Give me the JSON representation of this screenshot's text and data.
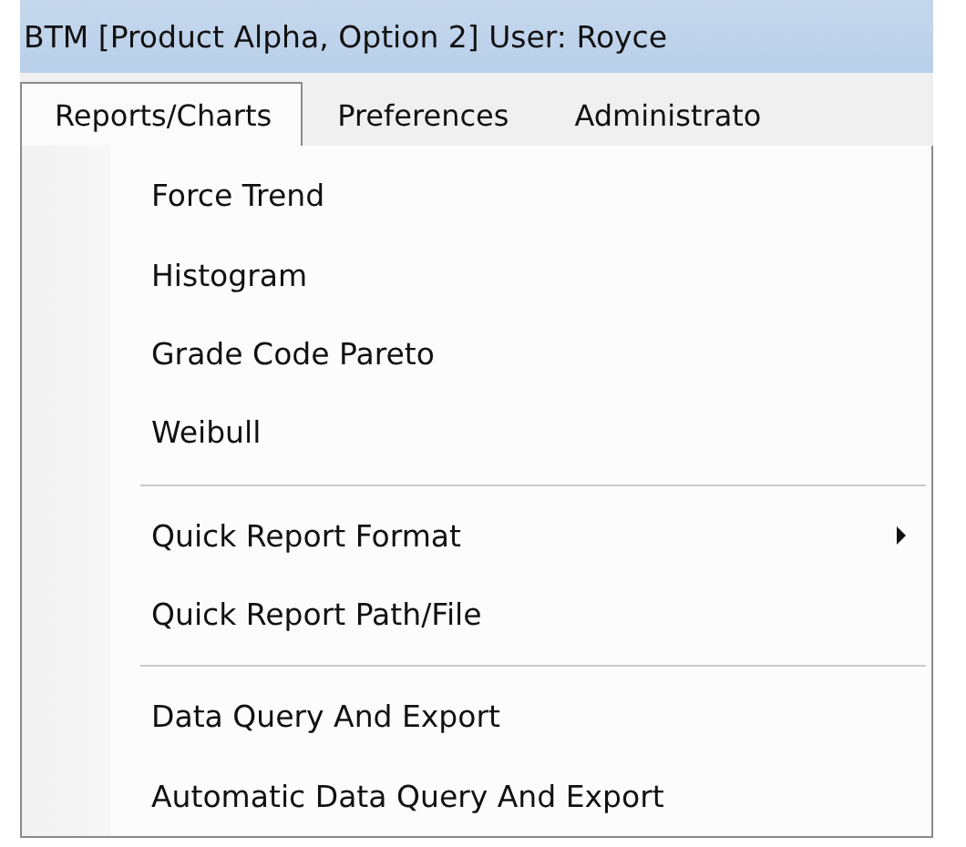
{
  "window": {
    "title": "BTM [Product Alpha, Option 2] User: Royce"
  },
  "menu_bar": [
    {
      "label": "Reports/Charts",
      "selected": true
    },
    {
      "label": "Preferences",
      "selected": false
    },
    {
      "label": "Administrato",
      "selected": false
    }
  ],
  "menu": [
    {
      "kind": "item",
      "label": "Force Trend",
      "submenu": false
    },
    {
      "kind": "item",
      "label": "Histogram",
      "submenu": false
    },
    {
      "kind": "item",
      "label": "Grade Code Pareto",
      "submenu": false
    },
    {
      "kind": "item",
      "label": "Weibull",
      "submenu": false
    },
    {
      "kind": "separator"
    },
    {
      "kind": "item",
      "label": "Quick Report Format",
      "submenu": true
    },
    {
      "kind": "item",
      "label": "Quick Report Path/File",
      "submenu": false
    },
    {
      "kind": "separator"
    },
    {
      "kind": "item",
      "label": "Data Query And Export",
      "submenu": false
    },
    {
      "kind": "item",
      "label": "Automatic Data Query And Export",
      "submenu": false
    }
  ]
}
